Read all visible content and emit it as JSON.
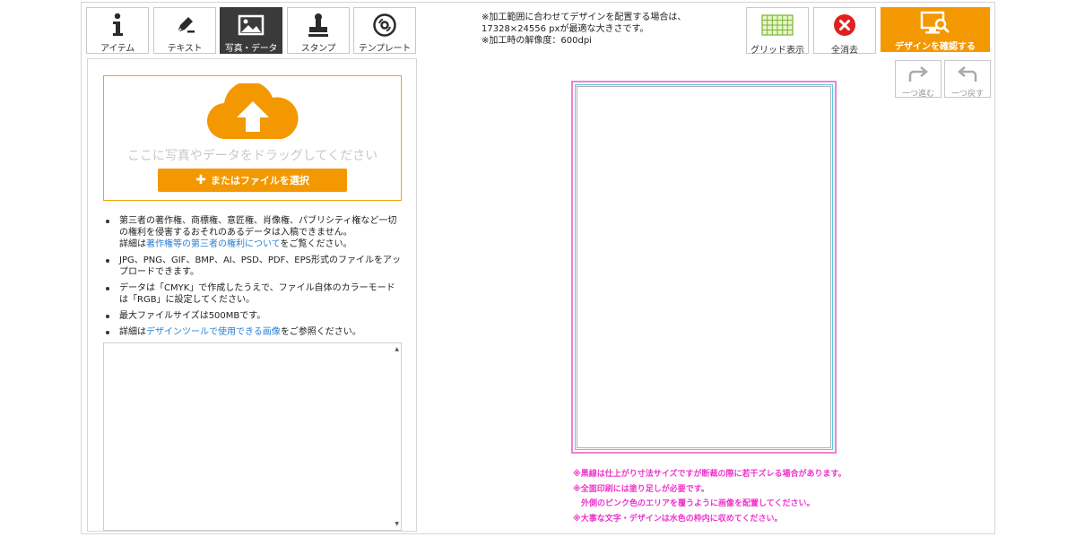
{
  "tabs": [
    {
      "label": "アイテム",
      "icon": "info-icon",
      "active": false
    },
    {
      "label": "テキスト",
      "icon": "pen-icon",
      "active": false
    },
    {
      "label": "写真・データ",
      "icon": "image-icon",
      "active": true
    },
    {
      "label": "スタンプ",
      "icon": "stamp-icon",
      "active": false
    },
    {
      "label": "テンプレート",
      "icon": "disc-icon",
      "active": false
    }
  ],
  "info": {
    "line1": "※加工範囲に合わせてデザインを配置する場合は、",
    "line2": "17328×24556 pxが最適な大きさです。",
    "line3": "※加工時の解像度：600dpi"
  },
  "toolbar": {
    "grid_label": "グリッド表示",
    "clear_label": "全消去",
    "confirm_label": "デザインを確認する",
    "redo_label": "一つ進む",
    "undo_label": "一つ戻す"
  },
  "upload": {
    "drop_hint": "ここに写真やデータをドラッグしてください",
    "select_label": "またはファイルを選択"
  },
  "notes": {
    "n1_text": "第三者の著作権、商標権、意匠権、肖像権、パブリシティ権など一切の権利を侵害するおそれのあるデータは入稿できません。",
    "n1_detail_prefix": "詳細は",
    "n1_link": "著作権等の第三者の権利について",
    "n1_suffix": "をご覧ください。",
    "n2": "JPG、PNG、GIF、BMP、AI、PSD、PDF、EPS形式のファイルをアップロードできます。",
    "n3": "データは「CMYK」で作成したうえで、ファイル自体のカラーモードは「RGB」に設定してください。",
    "n4": "最大ファイルサイズは500MBです。",
    "n5_prefix": "詳細は",
    "n5_link": "デザインツールで使用できる画像",
    "n5_suffix": "をご参照ください。"
  },
  "warnings": {
    "w1": "※黒線は仕上がり寸法サイズですが断裁の際に若干ズレる場合があります。",
    "w2": "※全面印刷には塗り足しが必要です。",
    "w3": "　外側のピンク色のエリアを覆うように画像を配置してください。",
    "w4": "※大事な文字・デザインは水色の枠内に収めてください。"
  },
  "colors": {
    "accent": "#f39800",
    "bleed": "#f080d0",
    "safe": "#55c8e8",
    "warning_text": "#ee33cc",
    "link": "#2a7fd4"
  }
}
